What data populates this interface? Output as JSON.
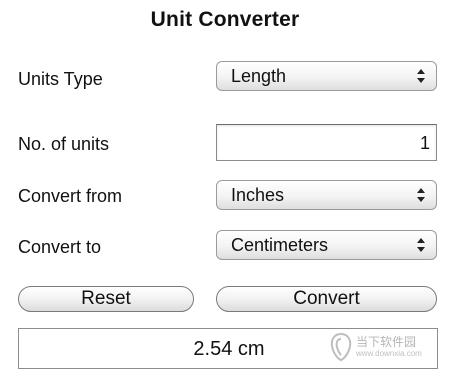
{
  "app": {
    "title": "Unit Converter"
  },
  "form": {
    "units_type": {
      "label": "Units Type",
      "value": "Length"
    },
    "num_units": {
      "label": "No. of units",
      "value": "1"
    },
    "convert_from": {
      "label": "Convert from",
      "value": "Inches"
    },
    "convert_to": {
      "label": "Convert to",
      "value": "Centimeters"
    }
  },
  "buttons": {
    "reset": "Reset",
    "convert": "Convert"
  },
  "result": {
    "text": "2.54 cm"
  },
  "watermark": {
    "cn": "当下软件园",
    "url": "www.downxia.com"
  },
  "icons": {
    "select_arrows": "up-down-arrows-icon",
    "watermark_logo": "downxia-logo-icon"
  }
}
